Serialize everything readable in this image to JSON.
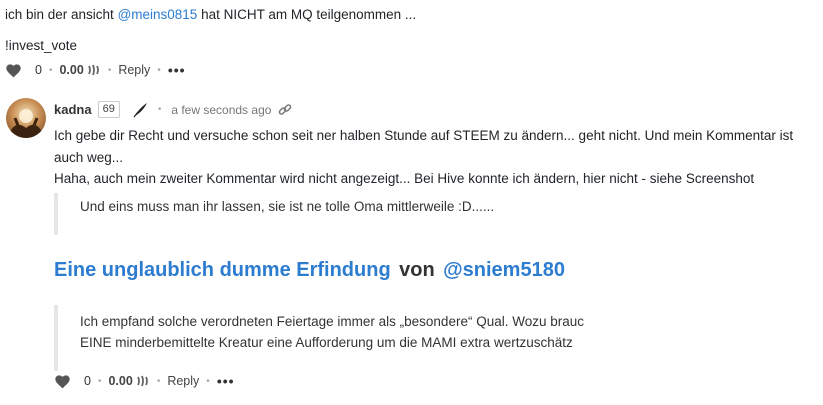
{
  "top_comment": {
    "text_before": "ich bin der ansicht ",
    "mention": "@meins0815",
    "text_after": " hat NICHT am MQ teilgenommen ...",
    "command": "!invest_vote",
    "votes": "0",
    "payout": "0.00",
    "reply_label": "Reply",
    "more_label": "•••"
  },
  "reply_comment": {
    "author": "kadna",
    "reputation": "69",
    "timestamp": "a few seconds ago",
    "body_line1": "Ich gebe dir Recht und versuche schon seit ner halben Stunde auf STEEM zu ändern... geht nicht. Und mein Kommentar ist",
    "body_line2": "auch weg...",
    "body_line3": "Haha, auch mein zweiter Kommentar wird nicht angezeigt... Bei Hive konnte ich ändern, hier nicht - siehe Screenshot",
    "quote": "Und eins muss man ihr lassen, sie ist ne tolle Oma mittlerweile :D......",
    "post_title": "Eine unglaublich dumme Erfindung",
    "post_by": "von",
    "post_author": "@sniem5180",
    "excerpt_line1": "Ich empfand solche verordneten Feiertage immer als „besondere“ Qual. Wozu brauc",
    "excerpt_line2": "EINE minderbemittelte Kreatur eine Aufforderung um die MAMI extra wertzuschätz",
    "votes": "0",
    "payout": "0.00",
    "reply_label": "Reply",
    "more_label": "•••"
  },
  "colors": {
    "link": "#2c7ccf",
    "text": "#212529",
    "muted": "#777777"
  }
}
